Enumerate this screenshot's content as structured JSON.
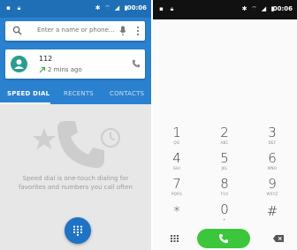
{
  "left_screen": {
    "status_bar": {
      "time": "00:06"
    },
    "search": {
      "placeholder": "Enter a name or phone..."
    },
    "recent_call": {
      "number": "112",
      "time_ago": "2 mins ago"
    },
    "tabs": [
      {
        "label": "SPEED DIAL",
        "active": true
      },
      {
        "label": "RECENTS",
        "active": false
      },
      {
        "label": "CONTACTS",
        "active": false
      }
    ],
    "empty_state": {
      "line1": "Speed dial is one-touch dialing for",
      "line2": "favorites and numbers you call often"
    },
    "colors": {
      "primary": "#2a81cf",
      "status": "#1f6fb6",
      "fab": "#1f73c4",
      "avatar": "#2a9d8f"
    }
  },
  "right_screen": {
    "status_bar": {
      "time": "00:06"
    },
    "keys": [
      {
        "digit": "1",
        "letters": "QO"
      },
      {
        "digit": "2",
        "letters": "ABC"
      },
      {
        "digit": "3",
        "letters": "DEF"
      },
      {
        "digit": "4",
        "letters": "GHI"
      },
      {
        "digit": "5",
        "letters": "JKL"
      },
      {
        "digit": "6",
        "letters": "MNO"
      },
      {
        "digit": "7",
        "letters": "PQRS"
      },
      {
        "digit": "8",
        "letters": "TUV"
      },
      {
        "digit": "9",
        "letters": "WXYZ"
      },
      {
        "digit": "*",
        "letters": ""
      },
      {
        "digit": "0",
        "letters": "+"
      },
      {
        "digit": "#",
        "letters": ""
      }
    ],
    "colors": {
      "dial_button": "#3cc63c",
      "status": "#111111"
    }
  }
}
